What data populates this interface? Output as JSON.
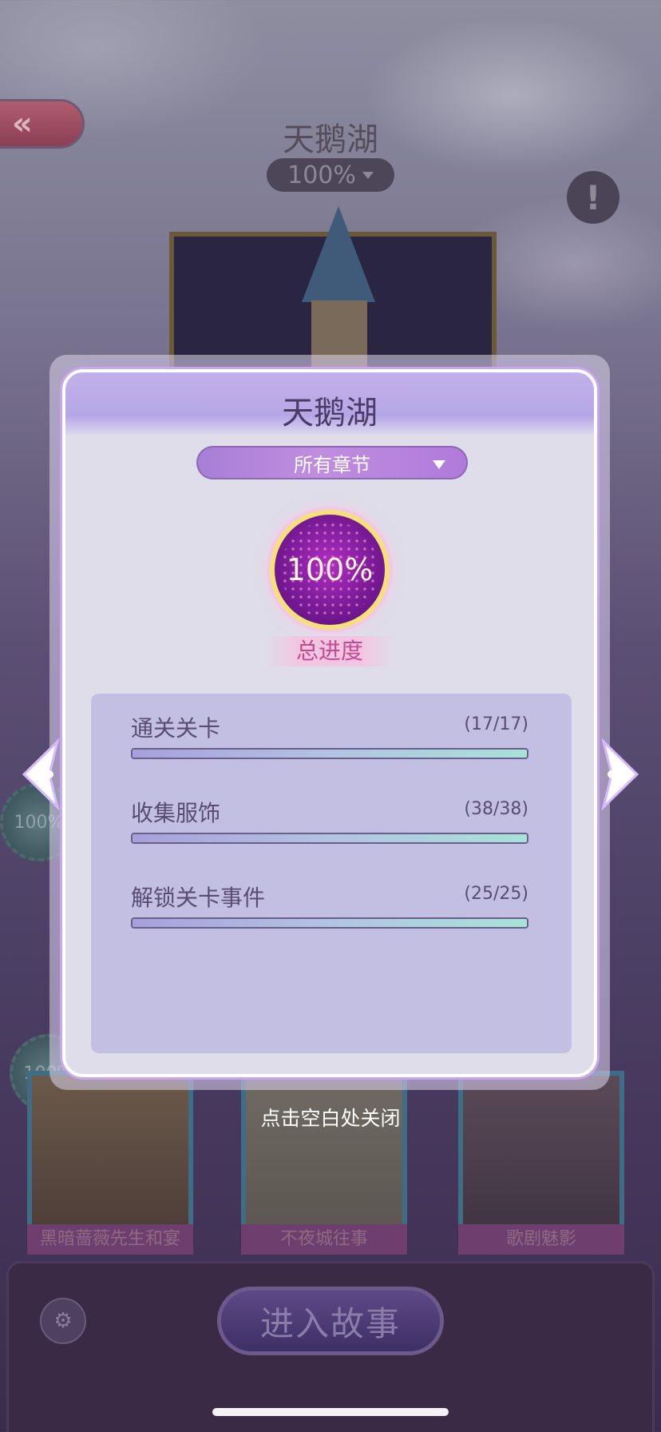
{
  "background": {
    "title": "天鹅湖",
    "percent": "100%",
    "badges": [
      "100%",
      "100%"
    ],
    "cards": [
      {
        "ribbon": "黑暗蔷薇先生和宴"
      },
      {
        "ribbon": "不夜城往事"
      },
      {
        "ribbon": "歌剧魅影"
      }
    ],
    "enter_button": "进入故事"
  },
  "modal": {
    "title": "天鹅湖",
    "chapter_select": "所有章节",
    "total_percent": "100%",
    "total_progress": 1.0,
    "total_label": "总进度",
    "stats": [
      {
        "label": "通关关卡",
        "count": "(17/17)",
        "progress": 1.0
      },
      {
        "label": "收集服饰",
        "count": "(38/38)",
        "progress": 1.0
      },
      {
        "label": "解锁关卡事件",
        "count": "(25/25)",
        "progress": 1.0
      }
    ]
  },
  "dismiss_hint": "点击空白处关闭",
  "colors": {
    "accent_purple": "#b07ada",
    "progress_gold": "#f6e07a",
    "total_label": "#c44a92"
  },
  "icons": {
    "back": "double-chevron-left-icon",
    "info": "exclamation-icon",
    "book": "storybook-settings-icon",
    "prev": "chevron-left-icon",
    "next": "chevron-right-icon",
    "dropdown": "triangle-down-icon"
  }
}
